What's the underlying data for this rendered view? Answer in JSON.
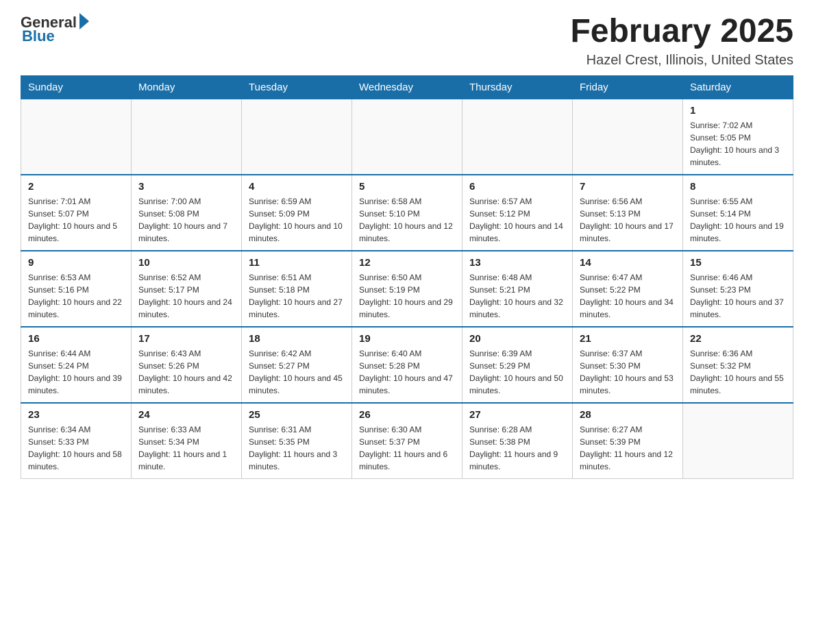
{
  "header": {
    "logo_general": "General",
    "logo_blue": "Blue",
    "month_year": "February 2025",
    "location": "Hazel Crest, Illinois, United States"
  },
  "weekdays": [
    "Sunday",
    "Monday",
    "Tuesday",
    "Wednesday",
    "Thursday",
    "Friday",
    "Saturday"
  ],
  "weeks": [
    [
      {
        "day": "",
        "info": ""
      },
      {
        "day": "",
        "info": ""
      },
      {
        "day": "",
        "info": ""
      },
      {
        "day": "",
        "info": ""
      },
      {
        "day": "",
        "info": ""
      },
      {
        "day": "",
        "info": ""
      },
      {
        "day": "1",
        "info": "Sunrise: 7:02 AM\nSunset: 5:05 PM\nDaylight: 10 hours and 3 minutes."
      }
    ],
    [
      {
        "day": "2",
        "info": "Sunrise: 7:01 AM\nSunset: 5:07 PM\nDaylight: 10 hours and 5 minutes."
      },
      {
        "day": "3",
        "info": "Sunrise: 7:00 AM\nSunset: 5:08 PM\nDaylight: 10 hours and 7 minutes."
      },
      {
        "day": "4",
        "info": "Sunrise: 6:59 AM\nSunset: 5:09 PM\nDaylight: 10 hours and 10 minutes."
      },
      {
        "day": "5",
        "info": "Sunrise: 6:58 AM\nSunset: 5:10 PM\nDaylight: 10 hours and 12 minutes."
      },
      {
        "day": "6",
        "info": "Sunrise: 6:57 AM\nSunset: 5:12 PM\nDaylight: 10 hours and 14 minutes."
      },
      {
        "day": "7",
        "info": "Sunrise: 6:56 AM\nSunset: 5:13 PM\nDaylight: 10 hours and 17 minutes."
      },
      {
        "day": "8",
        "info": "Sunrise: 6:55 AM\nSunset: 5:14 PM\nDaylight: 10 hours and 19 minutes."
      }
    ],
    [
      {
        "day": "9",
        "info": "Sunrise: 6:53 AM\nSunset: 5:16 PM\nDaylight: 10 hours and 22 minutes."
      },
      {
        "day": "10",
        "info": "Sunrise: 6:52 AM\nSunset: 5:17 PM\nDaylight: 10 hours and 24 minutes."
      },
      {
        "day": "11",
        "info": "Sunrise: 6:51 AM\nSunset: 5:18 PM\nDaylight: 10 hours and 27 minutes."
      },
      {
        "day": "12",
        "info": "Sunrise: 6:50 AM\nSunset: 5:19 PM\nDaylight: 10 hours and 29 minutes."
      },
      {
        "day": "13",
        "info": "Sunrise: 6:48 AM\nSunset: 5:21 PM\nDaylight: 10 hours and 32 minutes."
      },
      {
        "day": "14",
        "info": "Sunrise: 6:47 AM\nSunset: 5:22 PM\nDaylight: 10 hours and 34 minutes."
      },
      {
        "day": "15",
        "info": "Sunrise: 6:46 AM\nSunset: 5:23 PM\nDaylight: 10 hours and 37 minutes."
      }
    ],
    [
      {
        "day": "16",
        "info": "Sunrise: 6:44 AM\nSunset: 5:24 PM\nDaylight: 10 hours and 39 minutes."
      },
      {
        "day": "17",
        "info": "Sunrise: 6:43 AM\nSunset: 5:26 PM\nDaylight: 10 hours and 42 minutes."
      },
      {
        "day": "18",
        "info": "Sunrise: 6:42 AM\nSunset: 5:27 PM\nDaylight: 10 hours and 45 minutes."
      },
      {
        "day": "19",
        "info": "Sunrise: 6:40 AM\nSunset: 5:28 PM\nDaylight: 10 hours and 47 minutes."
      },
      {
        "day": "20",
        "info": "Sunrise: 6:39 AM\nSunset: 5:29 PM\nDaylight: 10 hours and 50 minutes."
      },
      {
        "day": "21",
        "info": "Sunrise: 6:37 AM\nSunset: 5:30 PM\nDaylight: 10 hours and 53 minutes."
      },
      {
        "day": "22",
        "info": "Sunrise: 6:36 AM\nSunset: 5:32 PM\nDaylight: 10 hours and 55 minutes."
      }
    ],
    [
      {
        "day": "23",
        "info": "Sunrise: 6:34 AM\nSunset: 5:33 PM\nDaylight: 10 hours and 58 minutes."
      },
      {
        "day": "24",
        "info": "Sunrise: 6:33 AM\nSunset: 5:34 PM\nDaylight: 11 hours and 1 minute."
      },
      {
        "day": "25",
        "info": "Sunrise: 6:31 AM\nSunset: 5:35 PM\nDaylight: 11 hours and 3 minutes."
      },
      {
        "day": "26",
        "info": "Sunrise: 6:30 AM\nSunset: 5:37 PM\nDaylight: 11 hours and 6 minutes."
      },
      {
        "day": "27",
        "info": "Sunrise: 6:28 AM\nSunset: 5:38 PM\nDaylight: 11 hours and 9 minutes."
      },
      {
        "day": "28",
        "info": "Sunrise: 6:27 AM\nSunset: 5:39 PM\nDaylight: 11 hours and 12 minutes."
      },
      {
        "day": "",
        "info": ""
      }
    ]
  ]
}
